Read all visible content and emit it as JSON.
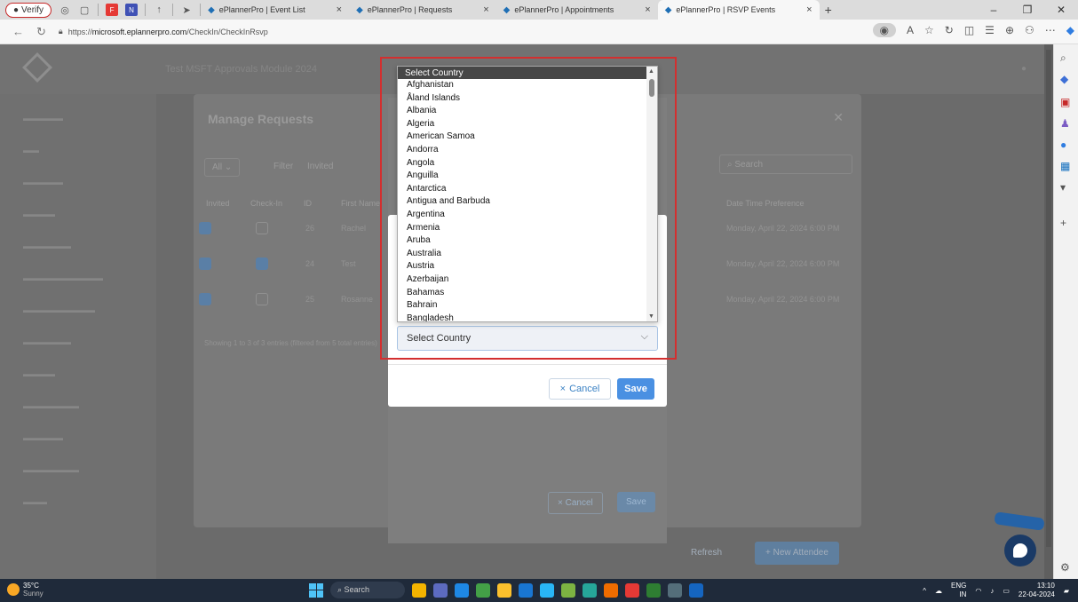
{
  "browser": {
    "verify_label": "Verify",
    "tabs": [
      {
        "label": "ePlannerPro | Event List"
      },
      {
        "label": "ePlannerPro | Requests"
      },
      {
        "label": "ePlannerPro | Appointments"
      },
      {
        "label": "ePlannerPro | RSVP Events"
      }
    ],
    "url_prefix": "https://",
    "url_host": "microsoft.eplannerpro.com",
    "url_path": "/CheckIn/CheckInRsvp"
  },
  "background_page": {
    "title": "Test MSFT Approvals Module 2024",
    "manage_title": "Manage Requests",
    "filter_all": "All",
    "filter_label": "Filter",
    "filter_value": "Invited",
    "search_placeholder": "Search",
    "columns": [
      "Invited",
      "Check-In",
      "ID",
      "First Name",
      "Date Time Preference"
    ],
    "rows": [
      {
        "id": "26",
        "first": "Rachel",
        "date": "Monday, April 22, 2024 6:00 PM"
      },
      {
        "id": "24",
        "first": "Test",
        "date": "Monday, April 22, 2024 6:00 PM"
      },
      {
        "id": "25",
        "first": "Rosanne",
        "date": "Monday, April 22, 2024 6:00 PM"
      }
    ],
    "showing": "Showing 1 to 3 of 3 entries (filtered from 5 total entries)",
    "back_cancel": "× Cancel",
    "back_save": "Save",
    "refresh": "Refresh",
    "new_attendee": "+ New Attendee"
  },
  "dialog": {
    "cancel_label": "Cancel",
    "save_label": "Save"
  },
  "country_select": {
    "selected": "Select Country",
    "options": [
      "Afghanistan",
      "Åland Islands",
      "Albania",
      "Algeria",
      "American Samoa",
      "Andorra",
      "Angola",
      "Anguilla",
      "Antarctica",
      "Antigua and Barbuda",
      "Argentina",
      "Armenia",
      "Aruba",
      "Australia",
      "Austria",
      "Azerbaijan",
      "Bahamas",
      "Bahrain",
      "Bangladesh"
    ]
  },
  "taskbar": {
    "temp": "35°C",
    "weather": "Sunny",
    "search": "Search",
    "lang": "ENG",
    "region": "IN",
    "time": "13:10",
    "date": "22-04-2024"
  }
}
